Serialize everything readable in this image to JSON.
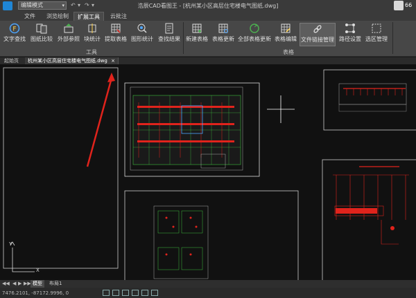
{
  "app": {
    "title": "浩辰CAD看图王 - [杭州某小区高层住宅楼电气图纸.dwg]",
    "mode_select": "编辑模式",
    "user_number": "66"
  },
  "menu_tabs": [
    {
      "label": "文件"
    },
    {
      "label": "浏览绘制"
    },
    {
      "label": "扩展工具"
    },
    {
      "label": "云批注"
    }
  ],
  "ribbon": {
    "tools_group": "工具",
    "table_group": "表格",
    "tools": [
      {
        "label": "文字查找",
        "icon": "text-search-icon"
      },
      {
        "label": "图纸比较",
        "icon": "compare-icon"
      },
      {
        "label": "外部参照",
        "icon": "xref-icon"
      },
      {
        "label": "块统计",
        "icon": "block-stats-icon"
      },
      {
        "label": "提取表格",
        "icon": "extract-table-icon"
      },
      {
        "label": "图形统计",
        "icon": "shape-stats-icon"
      },
      {
        "label": "查找结果",
        "icon": "find-results-icon"
      }
    ],
    "table_tools": [
      {
        "label": "新建表格",
        "icon": "new-table-icon"
      },
      {
        "label": "表格更新",
        "icon": "table-update-icon"
      },
      {
        "label": "全部表格更新",
        "icon": "update-all-icon"
      },
      {
        "label": "表格编辑",
        "icon": "table-edit-icon"
      },
      {
        "label": "文件链接管理",
        "icon": "link-manage-icon"
      },
      {
        "label": "路径设置",
        "icon": "path-settings-icon"
      },
      {
        "label": "选区管理",
        "icon": "selection-manage-icon"
      }
    ]
  },
  "doc_tabs": [
    {
      "label": "起始页"
    },
    {
      "label": "杭州某小区高层住宅楼电气图纸.dwg"
    }
  ],
  "layout_tabs": [
    {
      "label": "模型"
    },
    {
      "label": "布局1"
    }
  ],
  "status": {
    "coordinates": "7476.2101, -87172.9996, 0"
  },
  "colors": {
    "accent_red": "#e0231c",
    "ribbon_bg": "#474747",
    "canvas_bg": "#111111"
  }
}
